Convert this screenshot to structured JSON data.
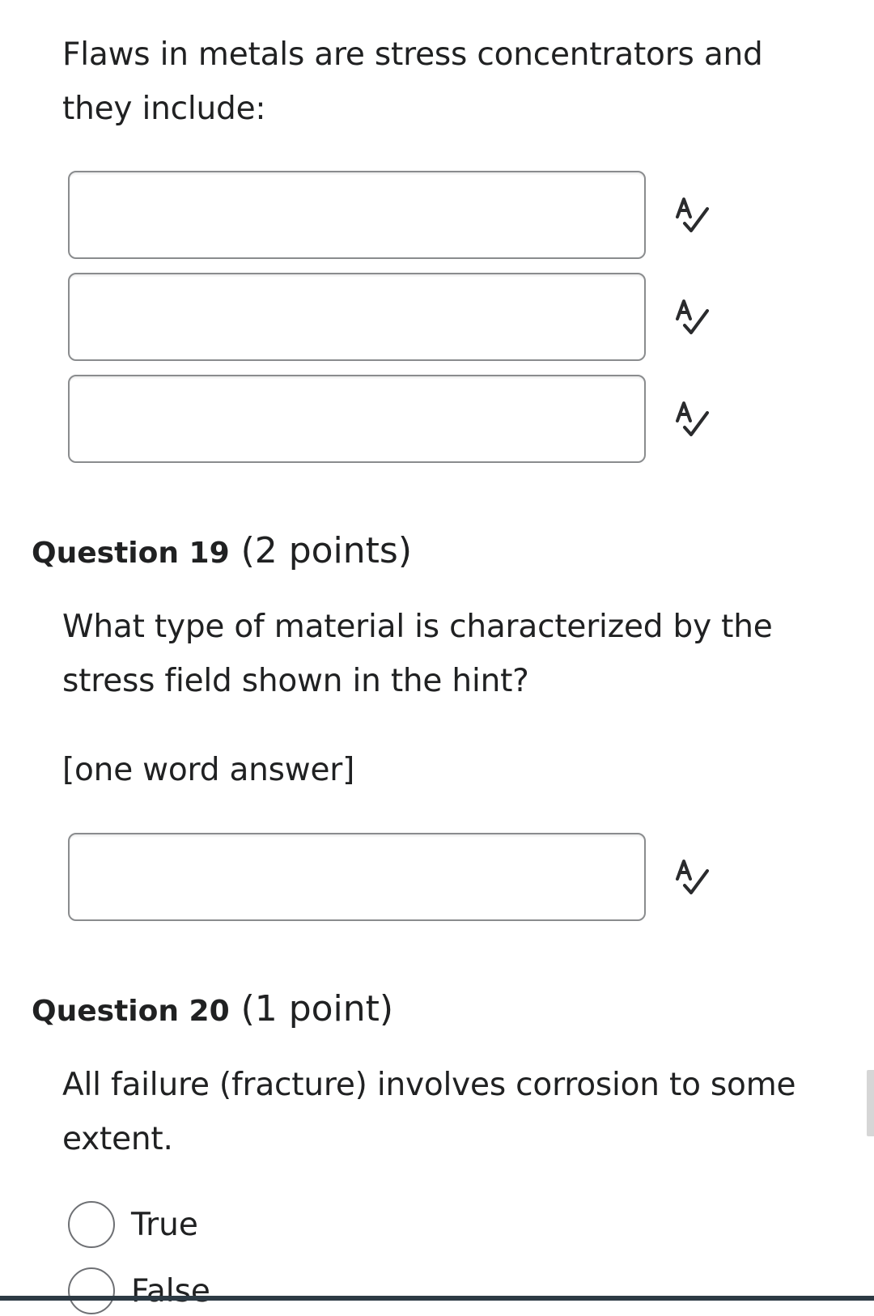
{
  "q18": {
    "prompt_line1": "Flaws in metals are stress concentrators and",
    "prompt_line2": "they include:",
    "answers": [
      {
        "value": "",
        "spellcheck_icon": "spellcheck-icon"
      },
      {
        "value": "",
        "spellcheck_icon": "spellcheck-icon"
      },
      {
        "value": "",
        "spellcheck_icon": "spellcheck-icon"
      }
    ]
  },
  "q19": {
    "label": "Question 19",
    "points": "(2 points)",
    "prompt_line1": "What type of material is characterized by the",
    "prompt_line2": "stress field shown in the hint?",
    "instruction": "[one word answer]",
    "answer": {
      "value": "",
      "spellcheck_icon": "spellcheck-icon"
    }
  },
  "q20": {
    "label": "Question 20",
    "points": "(1 point)",
    "prompt_line1": "All failure (fracture) involves corrosion to some",
    "prompt_line2": "extent.",
    "options": [
      "True",
      "False"
    ]
  },
  "colors": {
    "text": "#202122",
    "input_border": "#8a8c8e",
    "radio_border": "#6e7074",
    "bottom_bar": "#2d3a44"
  }
}
